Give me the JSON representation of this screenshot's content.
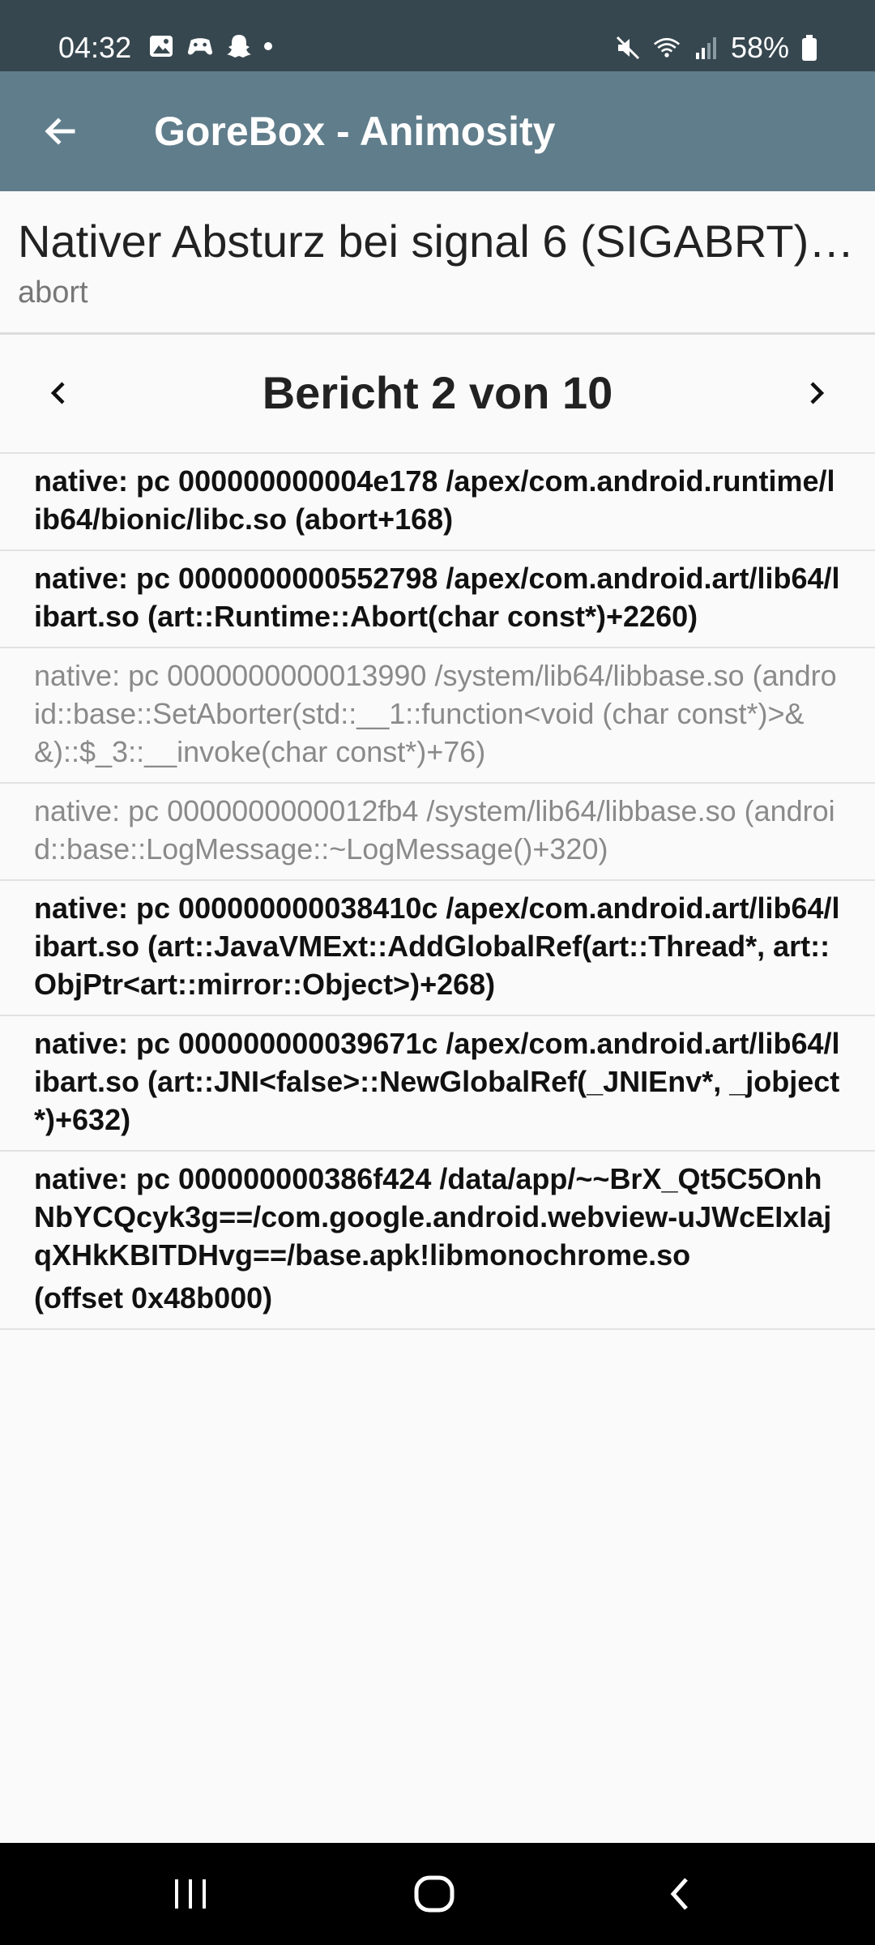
{
  "status": {
    "time": "04:32",
    "battery": "58%",
    "left_icons": [
      "image-icon",
      "gamepad-icon",
      "snapchat-icon",
      "dot-icon"
    ],
    "right_icons": [
      "mute-icon",
      "wifi-icon",
      "signal-icon",
      "battery-icon"
    ]
  },
  "appbar": {
    "title": "GoreBox - Animosity"
  },
  "header": {
    "title": "Nativer Absturz bei signal 6 (SIGABRT)…",
    "subtitle": "abort"
  },
  "pager": {
    "label": "Bericht 2 von 10"
  },
  "frames": [
    {
      "text": "native: pc 000000000004e178  /apex/com.android.runtime/lib64/bionic/libc.so (abort+168)",
      "style": "bold"
    },
    {
      "text": "native: pc 0000000000552798  /apex/com.android.art/lib64/libart.so (art::Runtime::Abort(char const*)+2260)",
      "style": "bold"
    },
    {
      "text": "native: pc 0000000000013990  /system/lib64/libbase.so (android::base::SetAborter(std::__1::function<void (char const*)>&&)::$_3::__invoke(char const*)+76)",
      "style": "dim"
    },
    {
      "text": "native: pc 0000000000012fb4  /system/lib64/libbase.so (android::base::LogMessage::~LogMessage()+320)",
      "style": "dim"
    },
    {
      "text": "native: pc 000000000038410c  /apex/com.android.art/lib64/libart.so (art::JavaVMExt::AddGlobalRef(art::Thread*, art::ObjPtr<art::mirror::Object>)+268)",
      "style": "bold"
    },
    {
      "text": "native: pc 000000000039671c  /apex/com.android.art/lib64/libart.so (art::JNI<false>::NewGlobalRef(_JNIEnv*, _jobject*)+632)",
      "style": "bold"
    },
    {
      "text": "native: pc 000000000386f424  /data/app/~~BrX_Qt5C5OnhNbYCQcyk3g==/com.google.android.webview-uJWcEIxIajqXHkKBITDHvg==/base.apk!libmonochrome.so",
      "extra": "(offset 0x48b000)",
      "style": "bold"
    }
  ],
  "navbar": {
    "icons": [
      "recents-icon",
      "home-icon",
      "back-icon"
    ]
  },
  "colors": {
    "statusbar": "#37474f",
    "appbar": "#607d8b",
    "background": "#fafafa",
    "dim_text": "#8a8a8a"
  }
}
